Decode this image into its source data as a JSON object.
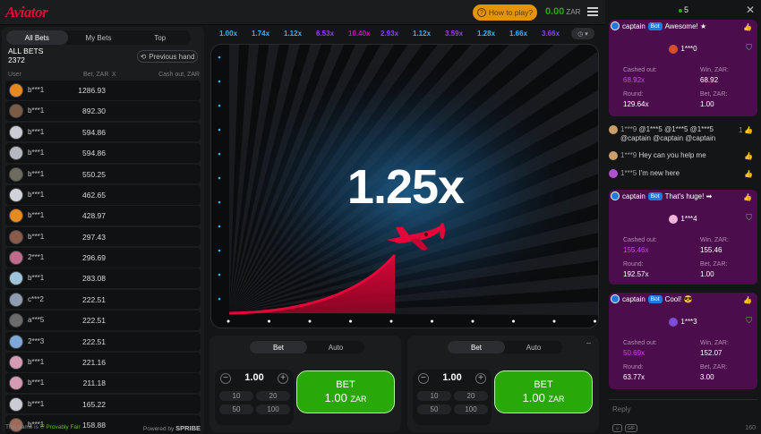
{
  "header": {
    "logo": "Aviator",
    "how_to_play": "How to play?",
    "balance": "0.00",
    "currency": "ZAR"
  },
  "bets_panel": {
    "tabs": [
      {
        "label": "All Bets",
        "active": true
      },
      {
        "label": "My Bets",
        "active": false
      },
      {
        "label": "Top",
        "active": false
      }
    ],
    "all_bets_label": "ALL BETS",
    "total": "2372",
    "previous_hand": "Previous hand",
    "columns": {
      "user": "User",
      "bet": "Bet, ZAR",
      "x": "X",
      "cashout": "Cash out, ZAR"
    },
    "rows": [
      {
        "user": "b***1",
        "bet": "1286.93",
        "color": "#e68a1f"
      },
      {
        "user": "b***1",
        "bet": "892.30",
        "color": "#7a5b45"
      },
      {
        "user": "b***1",
        "bet": "594.86",
        "color": "#c9cdd3"
      },
      {
        "user": "b***1",
        "bet": "594.86",
        "color": "#b5b9bf"
      },
      {
        "user": "b***1",
        "bet": "550.25",
        "color": "#6d6a5e"
      },
      {
        "user": "b***1",
        "bet": "462.65",
        "color": "#d0d4da"
      },
      {
        "user": "b***1",
        "bet": "428.97",
        "color": "#e68a1f"
      },
      {
        "user": "b***1",
        "bet": "297.43",
        "color": "#8a5a4a"
      },
      {
        "user": "2***1",
        "bet": "296.69",
        "color": "#c06b8c"
      },
      {
        "user": "b***1",
        "bet": "283.08",
        "color": "#9fc3d9"
      },
      {
        "user": "c***2",
        "bet": "222.51",
        "color": "#8f9bb0"
      },
      {
        "user": "a***5",
        "bet": "222.51",
        "color": "#6b6b6b"
      },
      {
        "user": "2***3",
        "bet": "222.51",
        "color": "#7fa6d9"
      },
      {
        "user": "b***1",
        "bet": "221.16",
        "color": "#d69ab4"
      },
      {
        "user": "b***1",
        "bet": "211.18",
        "color": "#d69ab4"
      },
      {
        "user": "b***1",
        "bet": "165.22",
        "color": "#c9cdd3"
      },
      {
        "user": "b***1",
        "bet": "158.88",
        "color": "#9e6b5a"
      }
    ],
    "footer": {
      "this_game_is": "This game is",
      "provably_fair": "Provably Fair",
      "powered_by": "Powered by",
      "provider": "SPRIBE"
    }
  },
  "multipliers": [
    {
      "value": "1.00x",
      "color": "#34b4ff"
    },
    {
      "value": "1.74x",
      "color": "#34b4ff"
    },
    {
      "value": "1.12x",
      "color": "#34b4ff"
    },
    {
      "value": "6.53x",
      "color": "#913ef8"
    },
    {
      "value": "10.40x",
      "color": "#c017b4"
    },
    {
      "value": "2.93x",
      "color": "#913ef8"
    },
    {
      "value": "1.12x",
      "color": "#34b4ff"
    },
    {
      "value": "3.59x",
      "color": "#913ef8"
    },
    {
      "value": "1.28x",
      "color": "#34b4ff"
    },
    {
      "value": "1.66x",
      "color": "#34b4ff"
    },
    {
      "value": "3.66x",
      "color": "#913ef8"
    }
  ],
  "game": {
    "multiplier": "1.25x",
    "curve_color": "#e50539",
    "plane_color": "#e50539"
  },
  "bet_panels": [
    {
      "tabs": [
        {
          "label": "Bet",
          "active": true
        },
        {
          "label": "Auto",
          "active": false
        }
      ],
      "minus": "−",
      "plus": "+",
      "amount": "1.00",
      "quick": [
        "10",
        "20",
        "50",
        "100"
      ],
      "bet_label": "BET",
      "bet_amount": "1.00",
      "bet_currency": "ZAR"
    },
    {
      "tabs": [
        {
          "label": "Bet",
          "active": true
        },
        {
          "label": "Auto",
          "active": false
        }
      ],
      "minus": "−",
      "plus": "+",
      "amount": "1.00",
      "quick": [
        "10",
        "20",
        "50",
        "100"
      ],
      "bet_label": "BET",
      "bet_amount": "1.00",
      "bet_currency": "ZAR",
      "collapse": "−"
    }
  ],
  "chat": {
    "online": "5",
    "close": "✕",
    "cards": [
      {
        "author": "captain",
        "badge": "Bot",
        "message": "Awesome! ★",
        "winner": "1***0",
        "cashed_out_label": "Cashed out:",
        "cashed_out": "68.92x",
        "win_label": "Win, ZAR:",
        "win": "68.92",
        "round_label": "Round:",
        "round": "129.64x",
        "bet_label": "Bet, ZAR:",
        "bet": "1.00",
        "winner_avatar": "#d94f2b"
      },
      {
        "author": "captain",
        "badge": "Bot",
        "message": "That's huge! ➡",
        "winner": "1***4",
        "cashed_out_label": "Cashed out:",
        "cashed_out": "155.46x",
        "win_label": "Win, ZAR:",
        "win": "155.46",
        "round_label": "Round:",
        "round": "192.57x",
        "bet_label": "Bet, ZAR:",
        "bet": "1.00",
        "winner_avatar": "#f1b3d9"
      },
      {
        "author": "captain",
        "badge": "Bot",
        "message": "Cool! 😎",
        "winner": "1***3",
        "cashed_out_label": "Cashed out:",
        "cashed_out": "50.69x",
        "win_label": "Win, ZAR:",
        "win": "152.07",
        "round_label": "Round:",
        "round": "63.77x",
        "bet_label": "Bet, ZAR:",
        "bet": "3.00",
        "winner_avatar": "#7a4fd9"
      }
    ],
    "messages": [
      {
        "name": "1***9",
        "text": "@1***5 @1***5 @1***5",
        "text2": "@captain @captain @captain",
        "likes": "1",
        "avatar": "#c9a06b"
      },
      {
        "name": "1***9",
        "text": "Hey can you help me",
        "avatar": "#c9a06b"
      },
      {
        "name": "1***5",
        "text": "I'm new here",
        "avatar": "#b04fd0"
      }
    ],
    "reply_placeholder": "Reply",
    "gif": "GIF",
    "limit": "160"
  }
}
